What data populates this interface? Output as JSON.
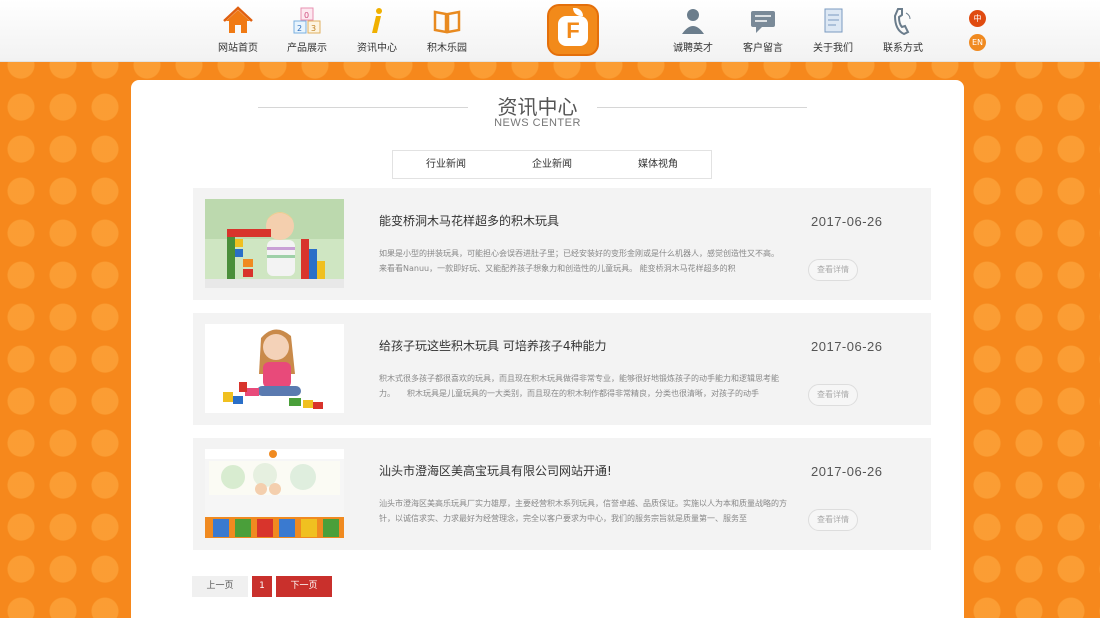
{
  "nav": {
    "left": [
      {
        "label": "网站首页",
        "icon": "home-icon"
      },
      {
        "label": "产品展示",
        "icon": "blocks-icon"
      },
      {
        "label": "资讯中心",
        "icon": "info-icon"
      },
      {
        "label": "积木乐园",
        "icon": "book-icon"
      }
    ],
    "right": [
      {
        "label": "诚聘英才",
        "icon": "person-icon"
      },
      {
        "label": "客户留言",
        "icon": "message-icon"
      },
      {
        "label": "关于我们",
        "icon": "document-icon"
      },
      {
        "label": "联系方式",
        "icon": "phone-icon"
      }
    ],
    "logo_letter": "F",
    "lang_cn": "中",
    "lang_en": "EN"
  },
  "section": {
    "title": "资讯中心",
    "subtitle": "NEWS CENTER"
  },
  "tabs": [
    "行业新闻",
    "企业新闻",
    "媒体视角"
  ],
  "news": [
    {
      "title": "能变桥洞木马花样超多的积木玩具",
      "summary": "如果是小型的拼装玩具，可能担心会误吞进肚子里；已经安装好的变形金刚或是什么机器人，感觉创造性又不高。　　来看看Nanuu，一款即好玩、又能配养孩子想象力和创造性的儿童玩具。 能变桥洞木马花样超多的积",
      "date": "2017-06-26",
      "more": "查看详情"
    },
    {
      "title": "给孩子玩这些积木玩具 可培养孩子4种能力",
      "summary": "积木式很多孩子都很喜欢的玩具，而且现在积木玩具做得非常专业，能够很好地锻炼孩子的动手能力和逻辑思考能力。　　积木玩具是儿童玩具的一大类别，而且现在的积木制作都得非常精良，分类也很清晰，对孩子的动手",
      "date": "2017-06-26",
      "more": "查看详情"
    },
    {
      "title": "汕头市澄海区美高宝玩具有限公司网站开通!",
      "summary": "汕头市澄海区美高乐玩具厂实力雄厚，主要经营积木系列玩具，信誉卓越、品质保证。实施以人为本和质量战略的方针，以诚信求实、力求最好为经营理念，完全以客户要求为中心，我们的服务宗旨就是质量第一、服务至",
      "date": "2017-06-26",
      "more": "查看详情"
    }
  ],
  "pagination": {
    "prev": "上一页",
    "current": "1",
    "next": "下一页"
  },
  "colors": {
    "accent": "#f28a1a",
    "page_red": "#c9302c"
  }
}
